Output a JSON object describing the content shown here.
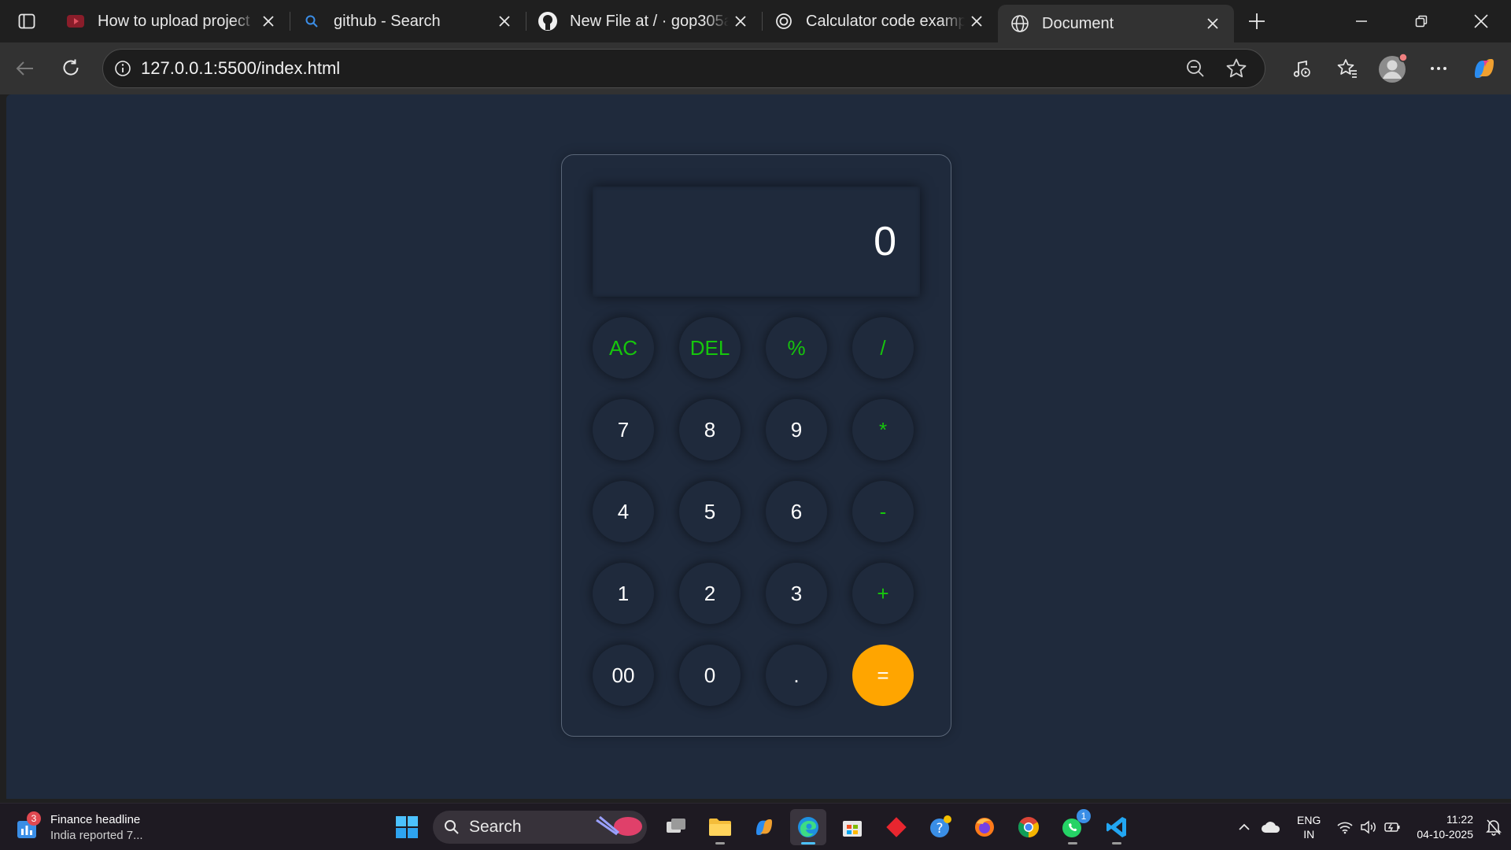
{
  "browser": {
    "tabs": [
      {
        "title": "How to upload project",
        "icon": "youtube-icon",
        "active": false
      },
      {
        "title": "github - Search",
        "icon": "search-icon",
        "active": false
      },
      {
        "title": "New File at / · gop305a",
        "icon": "github-icon",
        "active": false
      },
      {
        "title": "Calculator code examp",
        "icon": "chatgpt-icon",
        "active": false
      },
      {
        "title": "Document",
        "icon": "globe-icon",
        "active": true
      }
    ],
    "address": "127.0.0.1:5500/index.html"
  },
  "calculator": {
    "display": "0",
    "keys": [
      {
        "label": "AC",
        "kind": "op"
      },
      {
        "label": "DEL",
        "kind": "op"
      },
      {
        "label": "%",
        "kind": "op"
      },
      {
        "label": "/",
        "kind": "op"
      },
      {
        "label": "7",
        "kind": "num"
      },
      {
        "label": "8",
        "kind": "num"
      },
      {
        "label": "9",
        "kind": "num"
      },
      {
        "label": "*",
        "kind": "op"
      },
      {
        "label": "4",
        "kind": "num"
      },
      {
        "label": "5",
        "kind": "num"
      },
      {
        "label": "6",
        "kind": "num"
      },
      {
        "label": "-",
        "kind": "op"
      },
      {
        "label": "1",
        "kind": "num"
      },
      {
        "label": "2",
        "kind": "num"
      },
      {
        "label": "3",
        "kind": "num"
      },
      {
        "label": "+",
        "kind": "op"
      },
      {
        "label": "00",
        "kind": "num"
      },
      {
        "label": "0",
        "kind": "num"
      },
      {
        "label": ".",
        "kind": "num"
      },
      {
        "label": "=",
        "kind": "eq"
      }
    ],
    "colors": {
      "operator": "#16c60c",
      "equals": "#ffa500",
      "background": "#1f2a3c"
    }
  },
  "taskbar": {
    "widget": {
      "badge": "3",
      "headline": "Finance headline",
      "subtext": "India reported 7..."
    },
    "search_label": "Search",
    "whatsapp_badge": "1",
    "language": {
      "line1": "ENG",
      "line2": "IN"
    },
    "clock": {
      "time": "11:22",
      "date": "04-10-2025"
    }
  }
}
